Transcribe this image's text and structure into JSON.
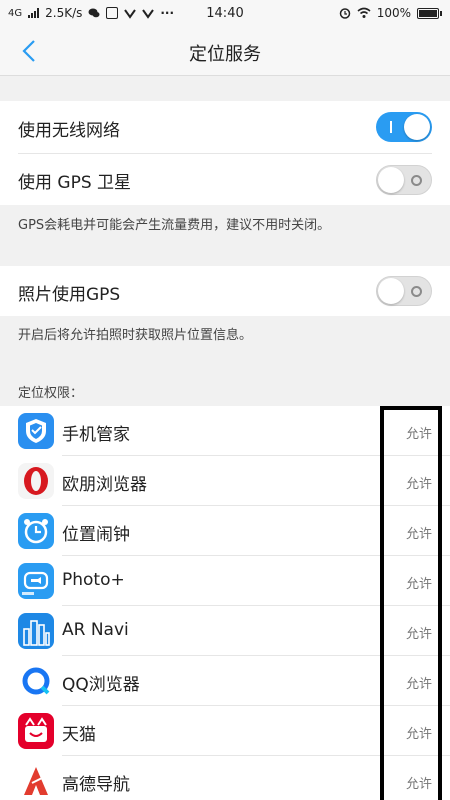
{
  "status_bar": {
    "network_type": "4G",
    "speed": "2.5K/s",
    "time": "14:40",
    "battery_percent": "100%",
    "battery_level": 1.0
  },
  "header": {
    "title": "定位服务",
    "back_icon": "chevron-left-icon"
  },
  "settings": {
    "wireless": {
      "label": "使用无线网络",
      "enabled": true
    },
    "gps": {
      "label": "使用 GPS 卫星",
      "enabled": false
    },
    "gps_note": "GPS会耗电并可能会产生流量费用，建议不用时关闭。",
    "photo_gps": {
      "label": "照片使用GPS",
      "enabled": false
    },
    "photo_note": "开启后将允许拍照时获取照片位置信息。"
  },
  "permissions": {
    "section_label": "定位权限：",
    "apps": [
      {
        "name": "手机管家",
        "permission": "允许",
        "icon": "shield-icon",
        "color": "#2a8ff0"
      },
      {
        "name": "欧朋浏览器",
        "permission": "允许",
        "icon": "opera-icon",
        "color": "#d71920"
      },
      {
        "name": "位置闹钟",
        "permission": "允许",
        "icon": "alarm-clock-icon",
        "color": "#2a9cf2"
      },
      {
        "name": "Photo+",
        "permission": "允许",
        "icon": "camera-icon",
        "color": "#2a9cf2"
      },
      {
        "name": "AR Navi",
        "permission": "允许",
        "icon": "city-icon",
        "color": "#1e88e5"
      },
      {
        "name": "QQ浏览器",
        "permission": "允许",
        "icon": "qq-browser-icon",
        "color": "#1976f3"
      },
      {
        "name": "天猫",
        "permission": "允许",
        "icon": "tmall-icon",
        "color": "#e4002b"
      },
      {
        "name": "高德导航",
        "permission": "允许",
        "icon": "amap-icon",
        "color": "#e23c2f"
      }
    ]
  },
  "colors": {
    "accent": "#2a9cf2",
    "background": "#f1f1f1",
    "row_background": "#ffffff"
  }
}
